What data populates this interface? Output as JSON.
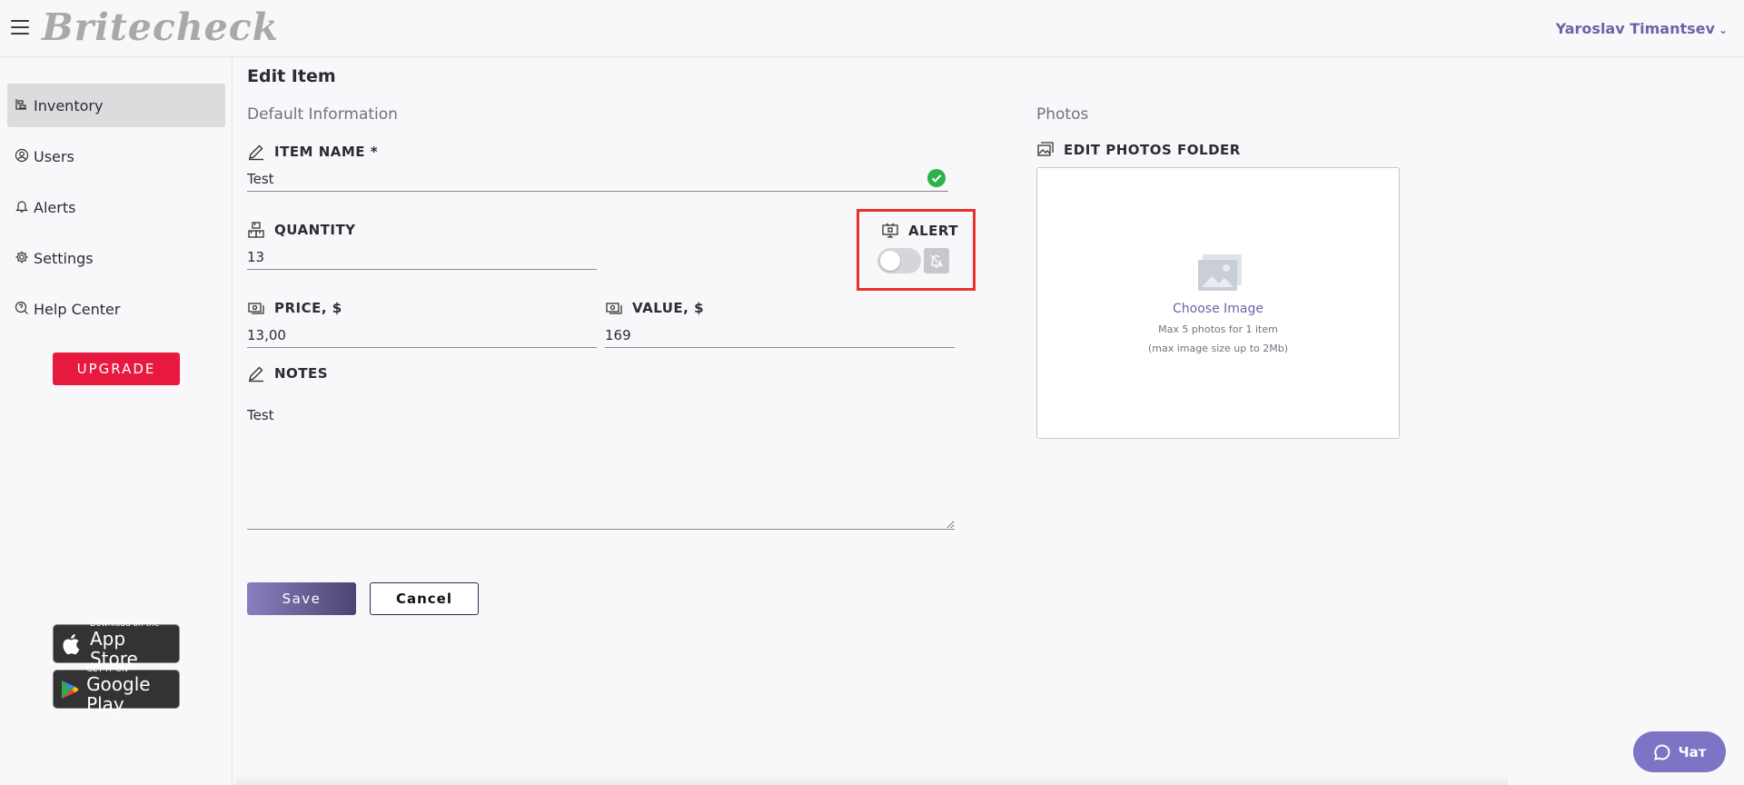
{
  "header": {
    "logo": "Britecheck",
    "user_name": "Yaroslav Timantsev"
  },
  "sidebar": {
    "items": [
      {
        "label": "Inventory",
        "icon": "inventory-icon",
        "active": true
      },
      {
        "label": "Users",
        "icon": "user-icon",
        "active": false
      },
      {
        "label": "Alerts",
        "icon": "bell-icon",
        "active": false
      },
      {
        "label": "Settings",
        "icon": "gear-icon",
        "active": false
      },
      {
        "label": "Help Center",
        "icon": "help-icon",
        "active": false
      }
    ],
    "upgrade_label": "UPGRADE",
    "app_store": {
      "small": "Download on the",
      "big": "App Store"
    },
    "google_play": {
      "small": "GET IT ON",
      "big": "Google Play"
    }
  },
  "form": {
    "title": "Edit Item",
    "section_default": "Default Information",
    "item_name": {
      "label": "ITEM NAME *",
      "value": "Test"
    },
    "quantity": {
      "label": "QUANTITY",
      "value": "13"
    },
    "alert": {
      "label": "ALERT",
      "enabled": false
    },
    "price": {
      "label": "PRICE, $",
      "value": "13,00"
    },
    "value": {
      "label": "VALUE, $",
      "value": "169"
    },
    "notes": {
      "label": "NOTES",
      "value": "Test"
    },
    "save_label": "Save",
    "cancel_label": "Cancel"
  },
  "photos": {
    "section": "Photos",
    "folder_label": "EDIT PHOTOS FOLDER",
    "choose": "Choose Image",
    "hint1": "Max 5 photos for 1 item",
    "hint2": "(max image size up to 2Mb)"
  },
  "chat": {
    "label": "Чат"
  },
  "colors": {
    "accent": "#6c63a8",
    "upgrade": "#e8193f",
    "highlight": "#e8312a",
    "success": "#2db34a"
  }
}
